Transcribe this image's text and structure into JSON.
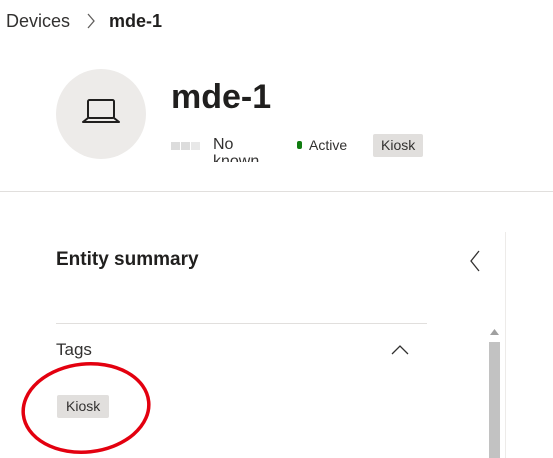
{
  "breadcrumb": {
    "parent_label": "Devices",
    "current_label": "mde-1"
  },
  "device": {
    "name": "mde-1",
    "avatar_icon": "laptop-icon",
    "risk_label": "No known",
    "status_text": "Active",
    "status_color": "#107c10",
    "tag": "Kiosk"
  },
  "entity_summary": {
    "title": "Entity summary",
    "collapse_icon": "chevron-left-icon",
    "tags_section": {
      "label": "Tags",
      "toggle_icon": "chevron-up-icon",
      "tags": [
        "Kiosk"
      ]
    }
  },
  "annotation": {
    "shape": "circle-highlight",
    "color": "#e3000f"
  },
  "colors": {
    "tag_background": "#e1dfdd",
    "divider": "#e1dfdd",
    "scroll_thumb": "#c2c2c2"
  }
}
